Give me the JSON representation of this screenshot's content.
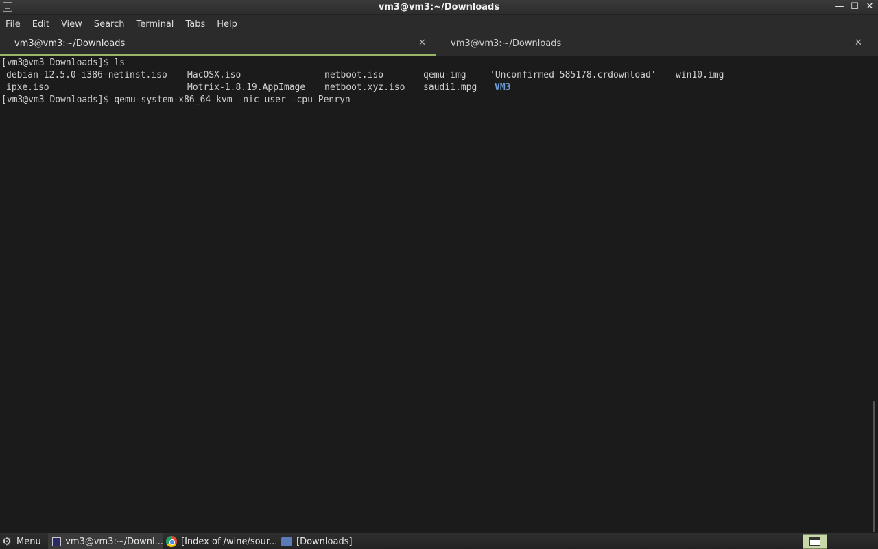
{
  "window": {
    "title": "vm3@vm3:~/Downloads",
    "minimize_glyph": "—",
    "maximize_glyph": "☐",
    "close_glyph": "✕"
  },
  "menu": [
    "File",
    "Edit",
    "View",
    "Search",
    "Terminal",
    "Tabs",
    "Help"
  ],
  "tabs": [
    {
      "label": "vm3@vm3:~/Downloads",
      "close": "✕",
      "active": true
    },
    {
      "label": "vm3@vm3:~/Downloads",
      "close": "✕",
      "active": false
    }
  ],
  "terminal": {
    "line1": "[vm3@vm3 Downloads]$ ls",
    "ls_row1": [
      "debian-12.5.0-i386-netinst.iso",
      "MacOSX.iso",
      "netboot.iso",
      "qemu-img",
      "'Unconfirmed 585178.crdownload'",
      "win10.img"
    ],
    "ls_row2": [
      "ipxe.iso",
      "Motrix-1.8.19.AppImage",
      "netboot.xyz.iso",
      "saudi1.mpg",
      "VM3"
    ],
    "line3": "[vm3@vm3 Downloads]$ qemu-system-x86_64 kvm -nic user -cpu Penryn"
  },
  "taskbar": {
    "menu_label": "Menu",
    "task_terminal": "vm3@vm3:~/Downl...",
    "task_browser": "[Index of /wine/sour...",
    "task_files": "[Downloads]"
  },
  "colors": {
    "accent_tab_underline": "#9bb567",
    "directory": "#6c9bd2",
    "background": "#1b1b1b"
  }
}
